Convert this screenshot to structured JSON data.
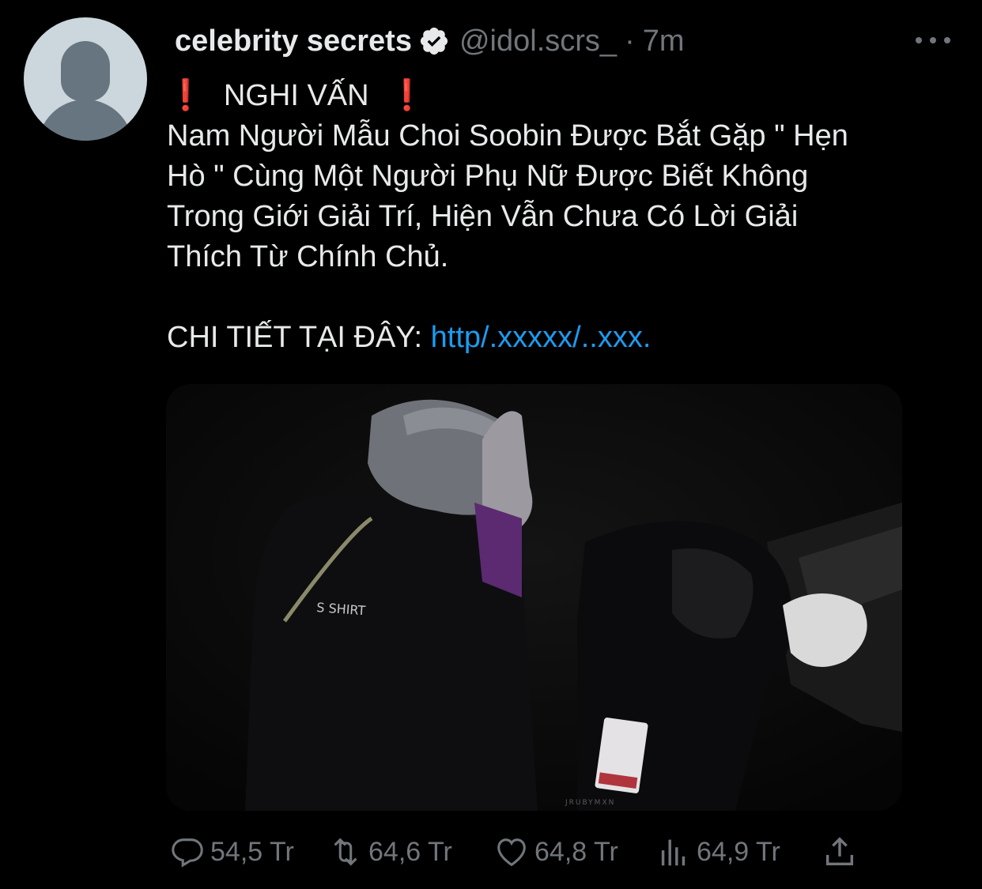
{
  "tweet": {
    "author_name": "celebrity secrets",
    "handle": "@idol.scrs_",
    "separator": "·",
    "time": "7m",
    "verified": true,
    "exclamation": "❗",
    "headline": "NGHI VẤN",
    "body_lines": [
      "Nam Người Mẫu Choi Soobin Được Bắt Gặp \" Hẹn",
      "Hò \" Cùng Một Người Phụ Nữ Được Biết Không",
      "Trong Giới Giải Trí, Hiện Vẫn Chưa Có Lời Giải",
      "Thích Từ Chính Chủ."
    ],
    "details_label": "CHI TIẾT TẠI ĐÂY:",
    "details_link": "http/.xxxxx/..xxx.",
    "media": {
      "icon": "photo",
      "text_on_clothing": "S SHIRT",
      "watermark": "JRUBYMXN"
    }
  },
  "actions": {
    "replies": "54,5 Tr",
    "retweets": "64,6 Tr",
    "likes": "64,8 Tr",
    "views": "64,9 Tr"
  },
  "colors": {
    "background": "#000000",
    "text": "#e7e9ea",
    "muted": "#71767b",
    "link": "#1d9bf0",
    "exclamation": "#e0242b"
  }
}
